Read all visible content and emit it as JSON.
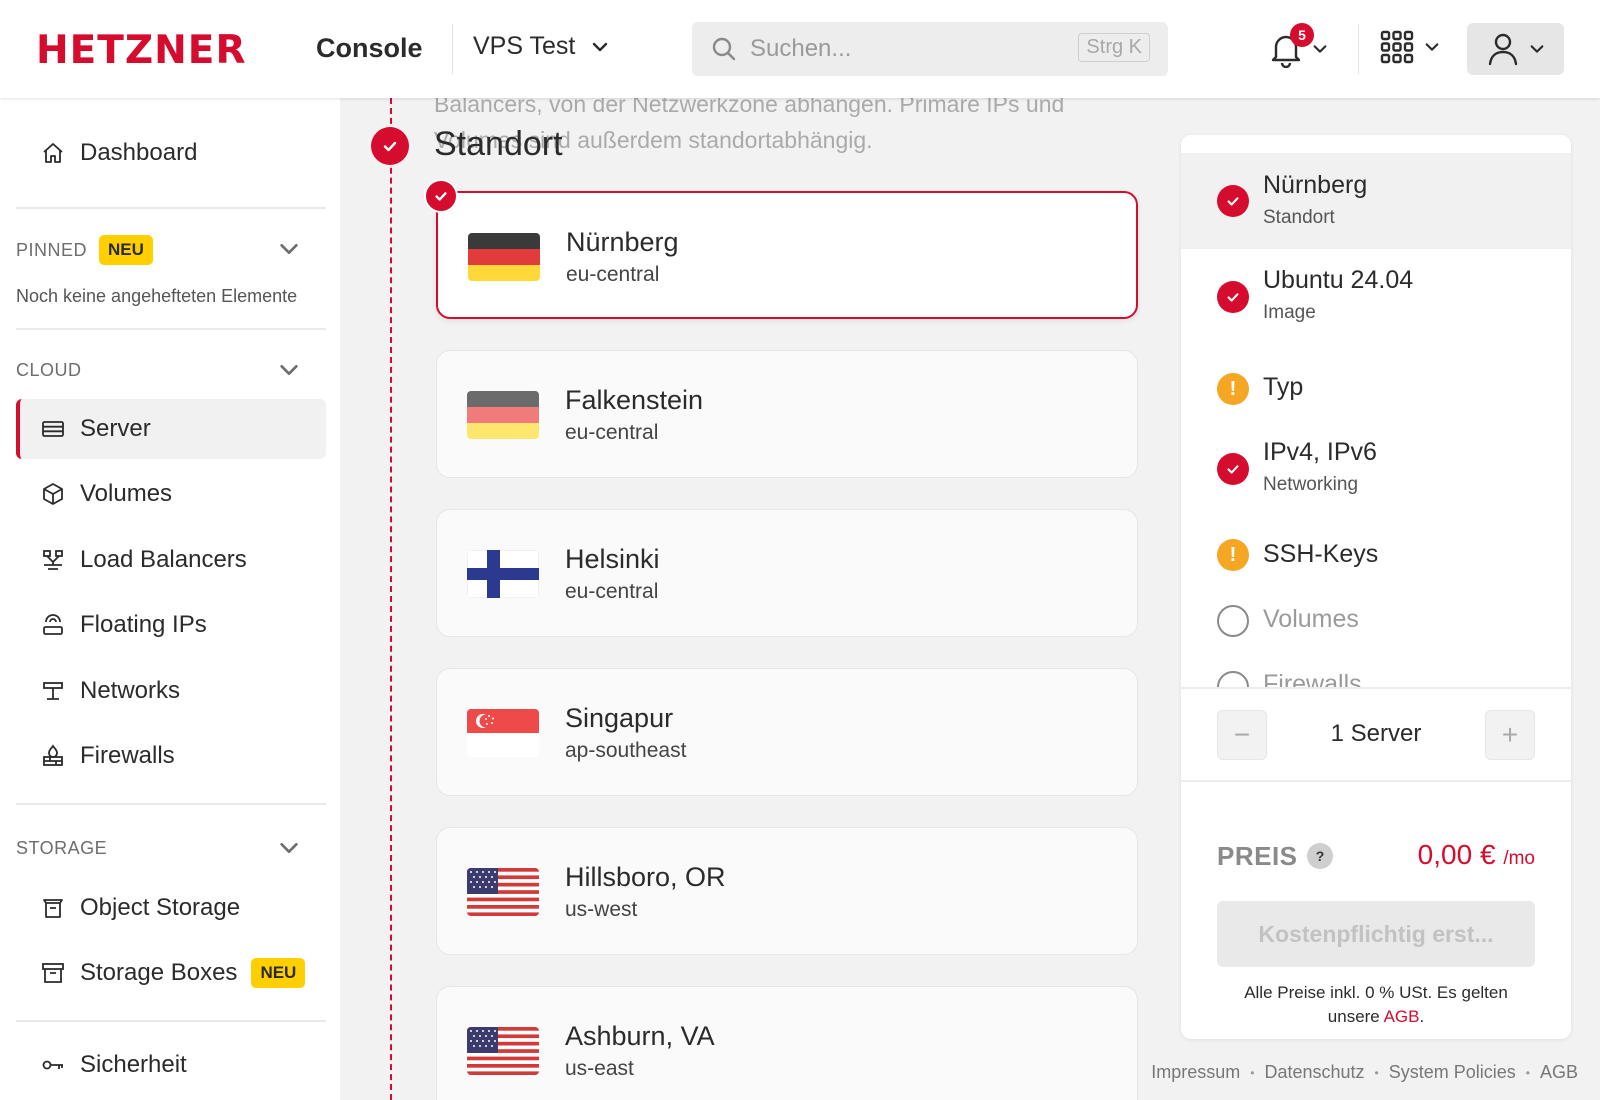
{
  "header": {
    "logo": "HETZNER",
    "app_name": "Console",
    "project": "VPS Test",
    "search_placeholder": "Suchen...",
    "search_shortcut": "Strg K",
    "notification_count": "5"
  },
  "sidebar": {
    "dashboard": "Dashboard",
    "pinned_title": "PINNED",
    "pinned_badge": "NEU",
    "pinned_empty": "Noch keine angehefteten Elemente",
    "cloud_title": "CLOUD",
    "cloud_items": [
      {
        "label": "Server",
        "icon": "server-icon"
      },
      {
        "label": "Volumes",
        "icon": "cube-icon"
      },
      {
        "label": "Load Balancers",
        "icon": "load-balancer-icon"
      },
      {
        "label": "Floating IPs",
        "icon": "floating-ip-icon"
      },
      {
        "label": "Networks",
        "icon": "network-icon"
      },
      {
        "label": "Firewalls",
        "icon": "firewall-icon"
      }
    ],
    "storage_title": "STORAGE",
    "storage_items": [
      {
        "label": "Object Storage",
        "icon": "bucket-icon"
      },
      {
        "label": "Storage Boxes",
        "icon": "archive-icon",
        "badge": "NEU"
      }
    ],
    "security": "Sicherheit"
  },
  "main": {
    "intro_line1": "Balancers, von der Netzwerkzone abhängen. Primäre IPs und",
    "intro_line2": "Volumes sind außerdem standortabhängig.",
    "section_title": "Standort",
    "locations": [
      {
        "city": "Nürnberg",
        "zone": "eu-central",
        "flag": "germany",
        "selected": true
      },
      {
        "city": "Falkenstein",
        "zone": "eu-central",
        "flag": "germany",
        "selected": false
      },
      {
        "city": "Helsinki",
        "zone": "eu-central",
        "flag": "finland",
        "selected": false
      },
      {
        "city": "Singapur",
        "zone": "ap-southeast",
        "flag": "singapore",
        "selected": false
      },
      {
        "city": "Hillsboro, OR",
        "zone": "us-west",
        "flag": "usa",
        "selected": false
      },
      {
        "city": "Ashburn, VA",
        "zone": "us-east",
        "flag": "usa",
        "selected": false
      }
    ]
  },
  "summary": {
    "items": [
      {
        "title": "Nürnberg",
        "subtitle": "Standort",
        "status": "done"
      },
      {
        "title": "Ubuntu 24.04",
        "subtitle": "Image",
        "status": "done"
      },
      {
        "title": "Typ",
        "subtitle": "",
        "status": "warning"
      },
      {
        "title": "IPv4, IPv6",
        "subtitle": "Networking",
        "status": "done"
      },
      {
        "title": "SSH-Keys",
        "subtitle": "",
        "status": "warning"
      },
      {
        "title": "Volumes",
        "subtitle": "",
        "status": "pending"
      },
      {
        "title": "Firewalls",
        "subtitle": "",
        "status": "pending"
      }
    ],
    "decrement": "−",
    "increment": "+",
    "server_count": "1 Server",
    "price_label": "PREIS",
    "price_help": "?",
    "price_value": "0,00 €",
    "price_unit": "/mo",
    "order_button": "Kostenpflichtig erst...",
    "vat_text": "Alle Preise inkl. 0 % USt. Es gelten unsere",
    "vat_link": "AGB",
    "vat_end": "."
  },
  "footer": [
    "Impressum",
    "Datenschutz",
    "System Policies",
    "AGB"
  ],
  "colors": {
    "brand_red": "#d50c2d",
    "warning": "#f5a623",
    "badge_yellow": "#ffcf00"
  }
}
